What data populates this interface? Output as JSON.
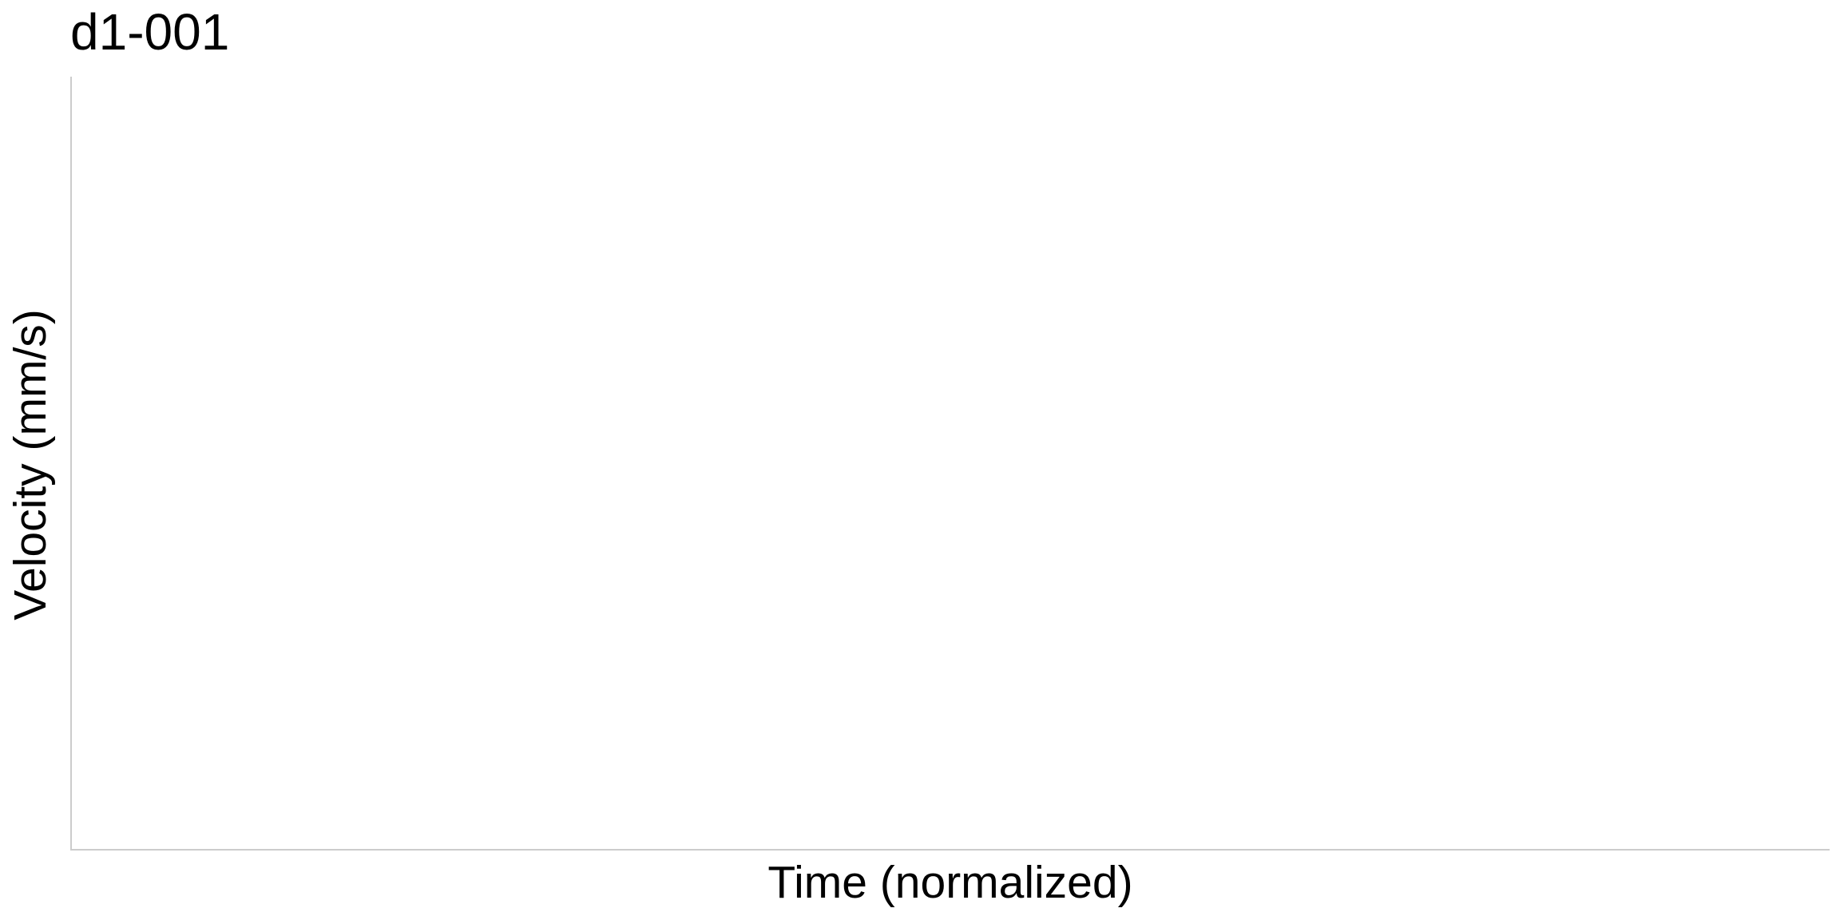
{
  "chart_data": {
    "type": "line",
    "title": "d1-001",
    "xlabel": "Time (normalized)",
    "ylabel": "Velocity (mm/s)",
    "series": [],
    "grid": false,
    "axis_color": "#cccccc",
    "text_color": "#000000",
    "background_color": "#ffffff"
  }
}
